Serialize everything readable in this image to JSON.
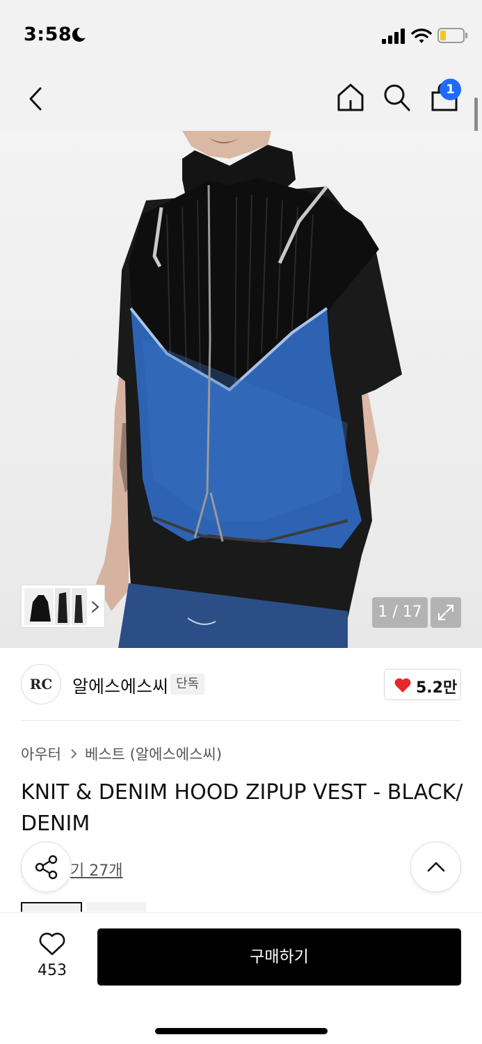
{
  "status_bar": {
    "time": "3:58"
  },
  "nav": {
    "cart_count": "1"
  },
  "gallery": {
    "counter": "1 / 17"
  },
  "brand": {
    "logo_text": "RC",
    "name": "알에스에스씨",
    "exclusive_label": "단독",
    "likes": "5.2만"
  },
  "breadcrumb": {
    "category": "아우터",
    "subcategory": "베스트 (알에스에스씨)"
  },
  "product": {
    "title": "KNIT & DENIM HOOD ZIPUP VEST - BLACK/DENIM",
    "reviews_link": "기 27개"
  },
  "bottom_bar": {
    "wish_count": "453",
    "buy_label": "구매하기"
  },
  "colors": {
    "accent_blue": "#1e6bff",
    "heart_red": "#e8272d",
    "buy_button": "#000000"
  },
  "icons": [
    "moon-icon",
    "signal-icon",
    "wifi-icon",
    "battery-icon",
    "back-icon",
    "home-icon",
    "search-icon",
    "cart-icon",
    "chevron-right-icon",
    "expand-icon",
    "heart-icon",
    "share-icon",
    "chevron-up-icon"
  ]
}
